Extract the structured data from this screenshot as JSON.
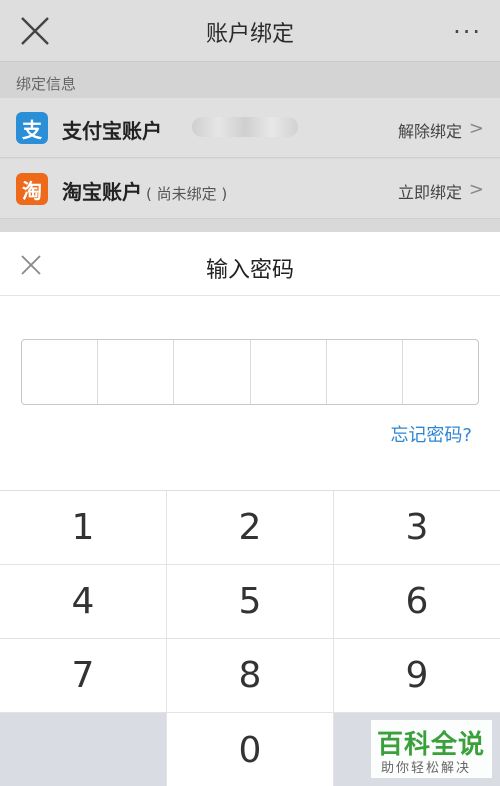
{
  "header": {
    "title": "账户绑定",
    "more_label": "···"
  },
  "section": {
    "label": "绑定信息"
  },
  "accounts": [
    {
      "icon": "支",
      "name": "支付宝账户",
      "sub": "",
      "action": "解除绑定",
      "chevron": ">"
    },
    {
      "icon": "淘",
      "name": "淘宝账户",
      "sub": "( 尚未绑定 )",
      "action": "立即绑定",
      "chevron": ">"
    }
  ],
  "dialog": {
    "title": "输入密码",
    "forgot": "忘记密码?",
    "keys": [
      "1",
      "2",
      "3",
      "4",
      "5",
      "6",
      "7",
      "8",
      "9",
      "",
      "0",
      ""
    ]
  },
  "watermark": {
    "big": "百科全说",
    "small": "助你轻松解决"
  },
  "colors": {
    "alipay": "#2a8fd6",
    "taobao": "#ee6a1b",
    "link": "#2f86d1"
  }
}
